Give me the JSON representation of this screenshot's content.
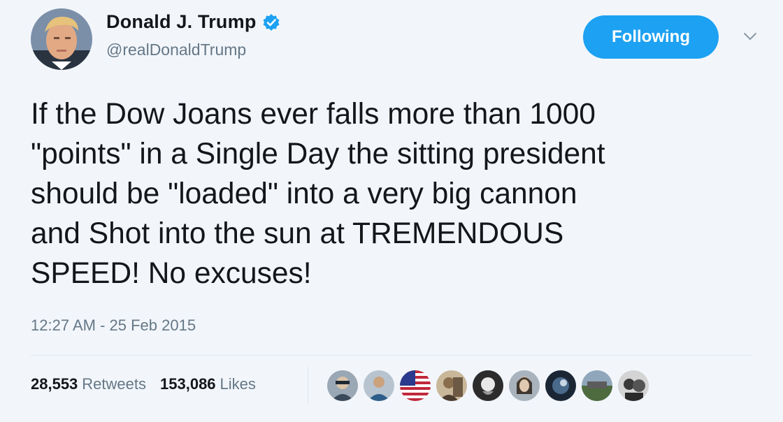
{
  "user": {
    "display_name": "Donald J. Trump",
    "handle": "@realDonaldTrump",
    "verified": true
  },
  "follow_button": {
    "label": "Following"
  },
  "tweet": {
    "text": "If the Dow Joans ever falls more than 1000\n\"points\" in a Single Day the sitting president\nshould be \"loaded\" into a very big cannon\nand Shot into the sun at TREMENDOUS\nSPEED! No excuses!",
    "timestamp": "12:27 AM - 25 Feb 2015"
  },
  "stats": {
    "retweets_count": "28,553",
    "retweets_label": "Retweets",
    "likes_count": "153,086",
    "likes_label": "Likes"
  },
  "icons": {
    "verified": "verified-badge-icon",
    "chevron": "chevron-down-icon"
  },
  "colors": {
    "accent": "#1da1f2",
    "text": "#14171a",
    "muted": "#657786",
    "background": "#f2f6fb"
  }
}
